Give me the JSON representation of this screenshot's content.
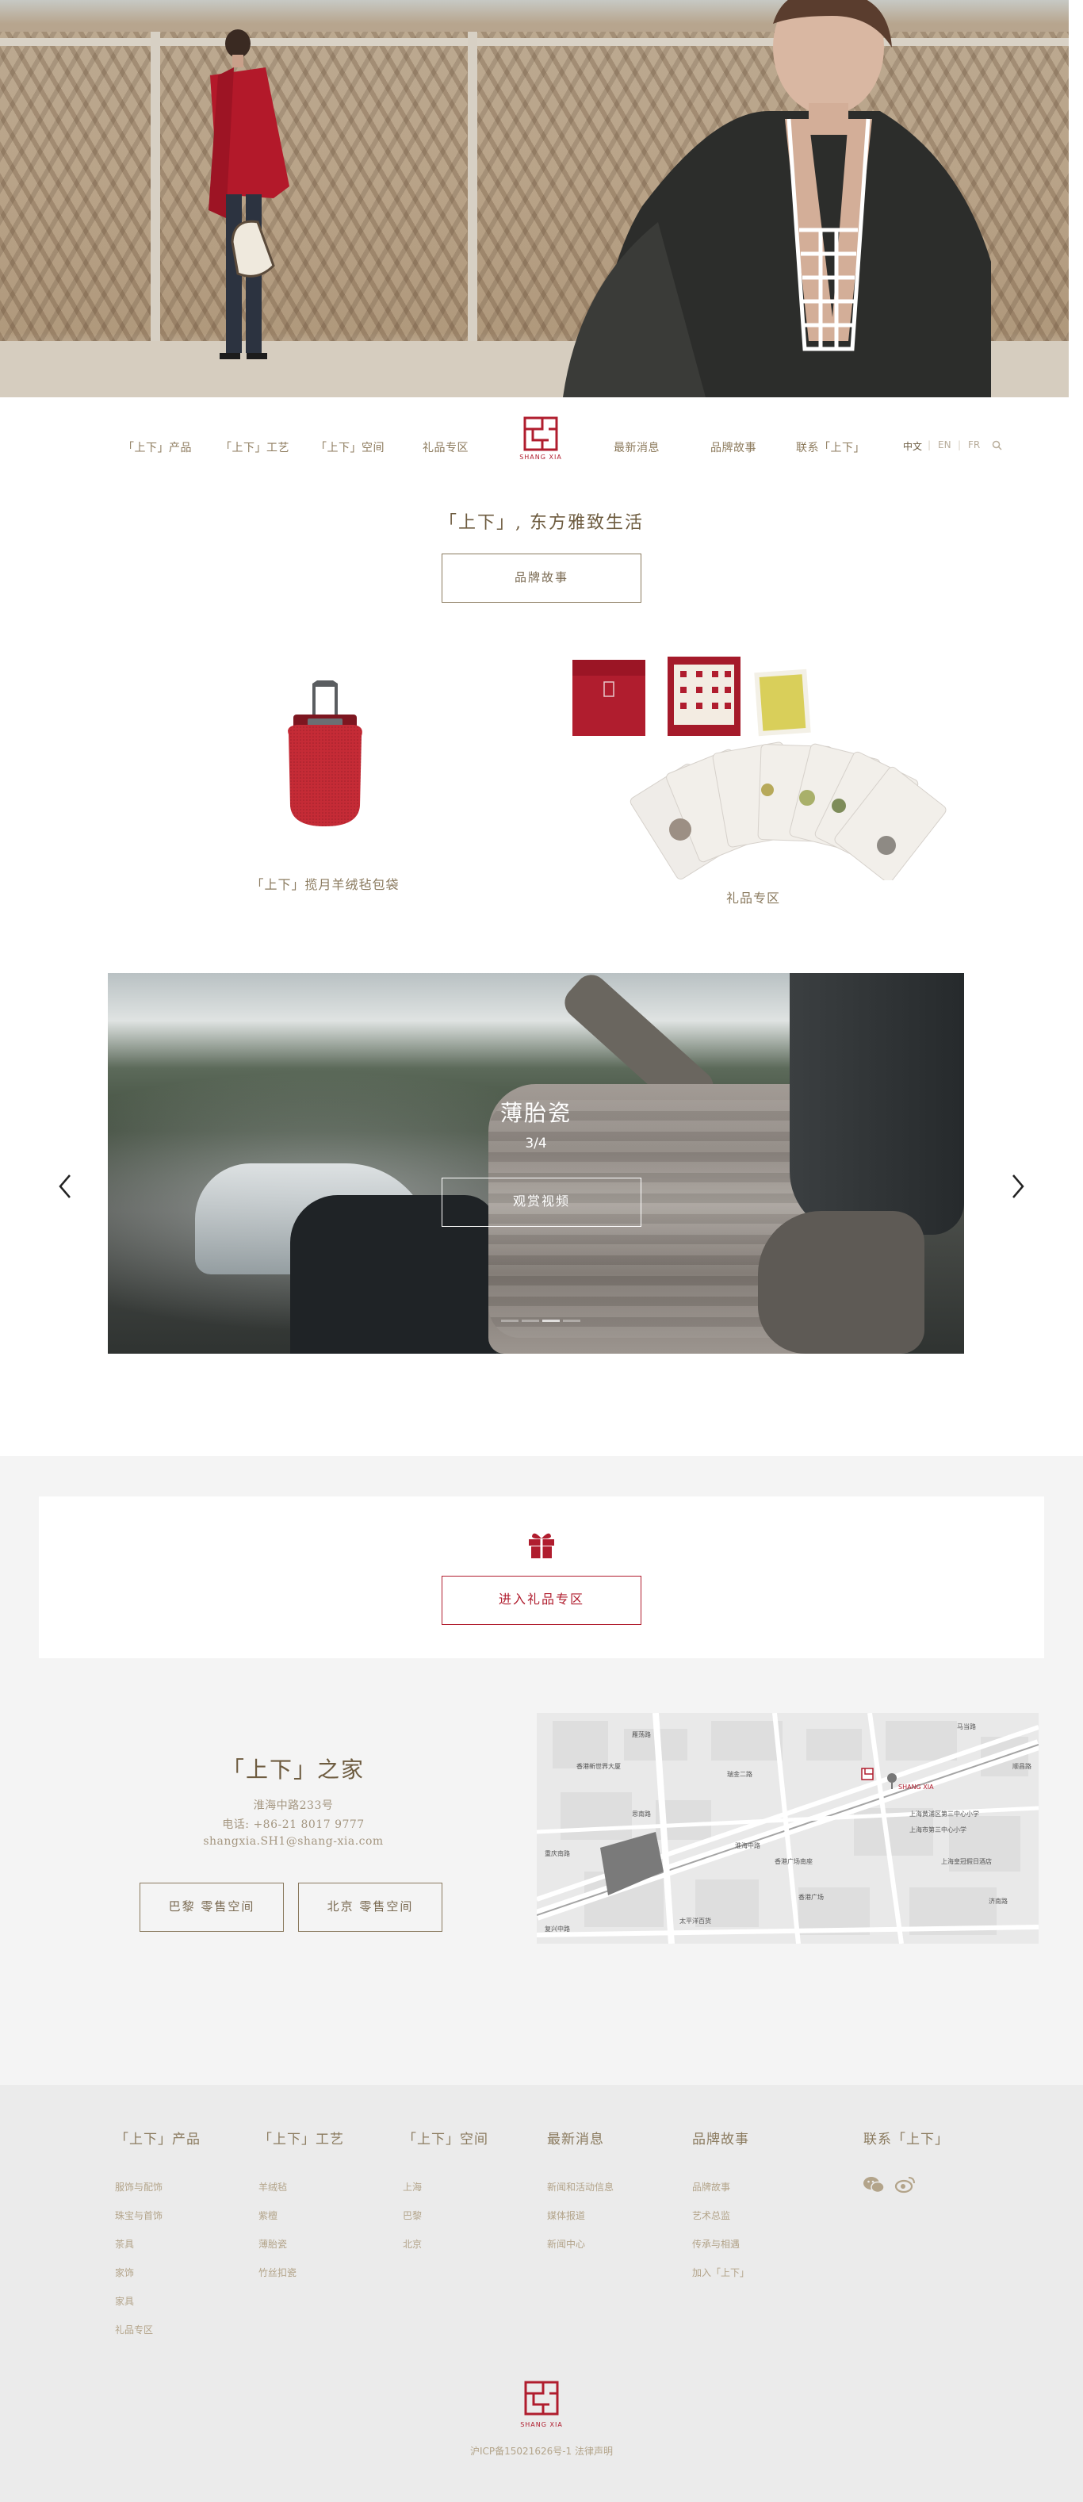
{
  "nav": {
    "left": [
      "「上下」产品",
      "「上下」工艺",
      "「上下」空间",
      "礼品专区"
    ],
    "right": [
      "最新消息",
      "品牌故事",
      "联系「上下」"
    ],
    "logo_text": "SHANG XIA",
    "languages": [
      "中文",
      "EN",
      "FR"
    ]
  },
  "brand": {
    "tagline": "「上下」, 东方雅致生活",
    "button": "品牌故事"
  },
  "products": [
    {
      "caption": "「上下」揽月羊绒毡包袋"
    },
    {
      "caption": "礼品专区"
    }
  ],
  "carousel": {
    "title": "薄胎瓷",
    "counter": "3/4",
    "button": "观赏视频",
    "slides": 4,
    "active": 3
  },
  "gift": {
    "button": "进入礼品专区"
  },
  "home": {
    "title": "「上下」之家",
    "address": "淮海中路233号",
    "phone": "电话: +86-21 8017 9777",
    "email": "shangxia.SH1@shang-xia.com",
    "stores": [
      "巴黎 零售空间",
      "北京 零售空间"
    ]
  },
  "map": {
    "labels": [
      "香港新世界大厦",
      "雁荡路",
      "瑞金二路",
      "淮海中路",
      "香港广场南座",
      "香港广场",
      "太平洋百货",
      "上海黄浦区第三中心小学",
      "上海皇冠假日酒店",
      "SHANG XIA",
      "马当路",
      "思南路",
      "复兴中路",
      "重庆南路",
      "济南路",
      "上海市第三中心小学",
      "顺昌路"
    ]
  },
  "footer": {
    "columns": [
      {
        "title": "「上下」产品",
        "items": [
          "服饰与配饰",
          "珠宝与首饰",
          "茶具",
          "家饰",
          "家具",
          "礼品专区"
        ]
      },
      {
        "title": "「上下」工艺",
        "items": [
          "羊绒毡",
          "紫檀",
          "薄胎瓷",
          "竹丝扣瓷"
        ]
      },
      {
        "title": "「上下」空间",
        "items": [
          "上海",
          "巴黎",
          "北京"
        ]
      },
      {
        "title": "最新消息",
        "items": [
          "新闻和活动信息",
          "媒体报道",
          "新闻中心"
        ]
      },
      {
        "title": "品牌故事",
        "items": [
          "品牌故事",
          "艺术总监",
          "传承与相遇",
          "加入「上下」"
        ]
      },
      {
        "title": "联系「上下」",
        "items": []
      }
    ],
    "logo_text": "SHANG XIA",
    "icp": "沪ICP备15021626号-1  法律声明"
  },
  "colors": {
    "brand_red": "#b01d2e",
    "text_gold": "#8a7a5e",
    "gray_bg": "#f4f4f4",
    "footer_bg": "#ebebeb"
  },
  "icons": [
    "search-icon",
    "gift-icon",
    "wechat-icon",
    "weibo-icon",
    "chevron-left-icon",
    "chevron-right-icon",
    "shang-xia-logo"
  ]
}
